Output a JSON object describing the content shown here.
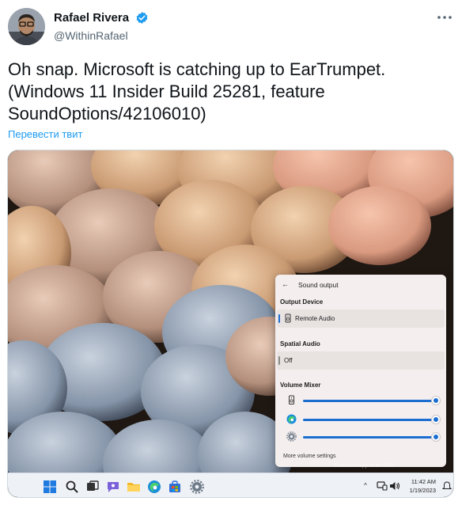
{
  "tweet": {
    "display_name": "Rafael Rivera",
    "handle": "@WithinRafael",
    "text_line1": "Oh snap. Microsoft is catching up to EarTrumpet.",
    "text_line2": "(Windows 11 Insider Build 25281, feature",
    "text_line3": "SoundOptions/42106010)",
    "translate_label": "Перевести твит",
    "verified_color": "#1d9bf0",
    "more_icon": "more-dots-icon"
  },
  "screenshot": {
    "flyout": {
      "title": "Sound output",
      "output_device_label": "Output Device",
      "output_device_value": "Remote Audio",
      "spatial_audio_label": "Spatial Audio",
      "spatial_audio_value": "Off",
      "volume_mixer_label": "Volume Mixer",
      "mixer_apps": [
        {
          "icon": "speaker-device-icon",
          "level": 1.0
        },
        {
          "icon": "edge-icon",
          "level": 1.0
        },
        {
          "icon": "settings-gear-icon",
          "level": 1.0
        }
      ],
      "more_settings": "More volume settings",
      "accent_color": "#1c6dd0"
    },
    "taskbar": {
      "icons": [
        "windows-start-icon",
        "search-icon",
        "task-view-icon",
        "teams-chat-icon",
        "file-explorer-icon",
        "edge-icon",
        "store-icon",
        "settings-icon"
      ],
      "tray_chevron": "^",
      "time": "11:42 AM",
      "date": "1/19/2023",
      "watermark": "Evaluation copy. Build 25281"
    }
  }
}
